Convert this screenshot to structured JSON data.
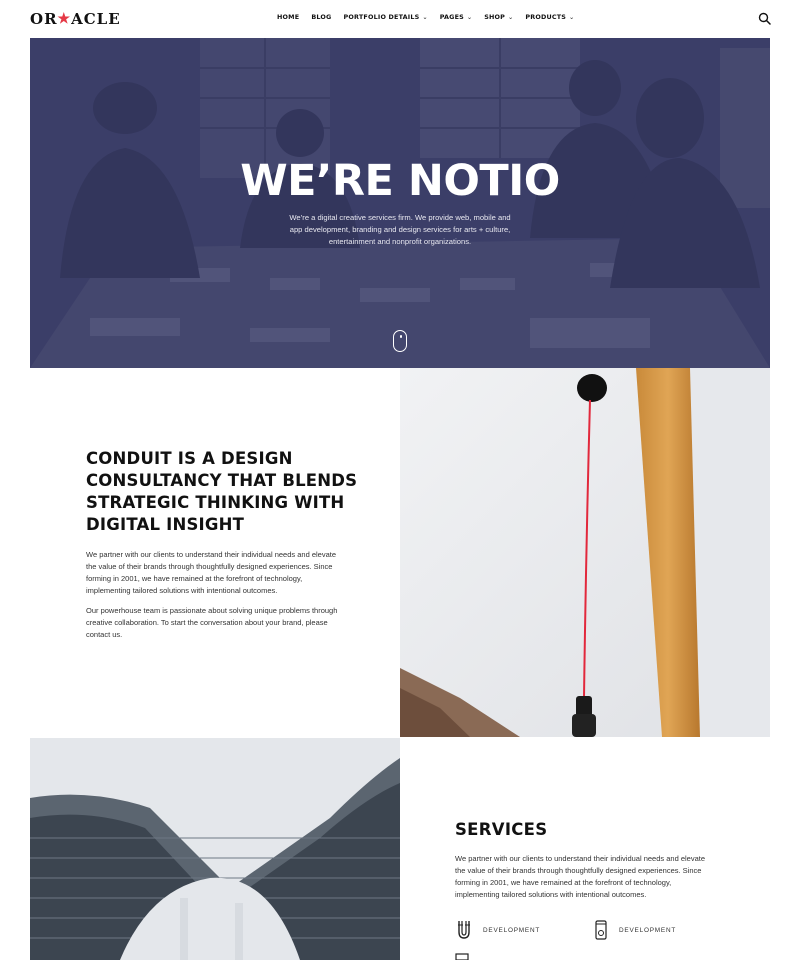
{
  "header": {
    "logo": {
      "prefix": "OR",
      "star": "★",
      "suffix": "ACLE"
    },
    "nav": [
      {
        "label": "HOME",
        "dropdown": false
      },
      {
        "label": "BLOG",
        "dropdown": false
      },
      {
        "label": "PORTFOLIO DETAILS",
        "dropdown": true
      },
      {
        "label": "PAGES",
        "dropdown": true
      },
      {
        "label": "SHOP",
        "dropdown": true
      },
      {
        "label": "PRODUCTS",
        "dropdown": true
      }
    ],
    "search_icon": "search-icon"
  },
  "hero": {
    "title": "WE’RE NOTIO",
    "subtitle": "We’re a digital creative services firm. We provide web, mobile and app development, branding and design services for arts + culture, entertainment and nonprofit organizations.",
    "overlay_color": "#3a3d66"
  },
  "intro": {
    "heading": "CONDUIT IS A DESIGN CONSULTANCY THAT BLENDS STRATEGIC THINKING WITH DIGITAL INSIGHT",
    "paragraph1": "We partner with our clients to understand their individual needs and elevate the value of their brands through thoughtfully designed experiences. Since forming in 2001, we have remained at the forefront of technology, implementing tailored solutions with intentional outcomes.",
    "paragraph2": "Our powerhouse team is passionate about solving unique problems through creative collaboration. To start the conversation about your brand, please contact us."
  },
  "services": {
    "heading": "SERVICES",
    "paragraph": "We partner with our clients to understand their individual needs and elevate the value of their brands through thoughtfully designed experiences. Since forming in 2001, we have remained at the forefront of technology, implementing tailored solutions with intentional outcomes.",
    "items": [
      {
        "label": "DEVELOPMENT",
        "icon": "magnet-icon"
      },
      {
        "label": "DEVELOPMENT",
        "icon": "device-icon"
      }
    ]
  },
  "colors": {
    "accent": "#e53946",
    "text": "#111111"
  }
}
